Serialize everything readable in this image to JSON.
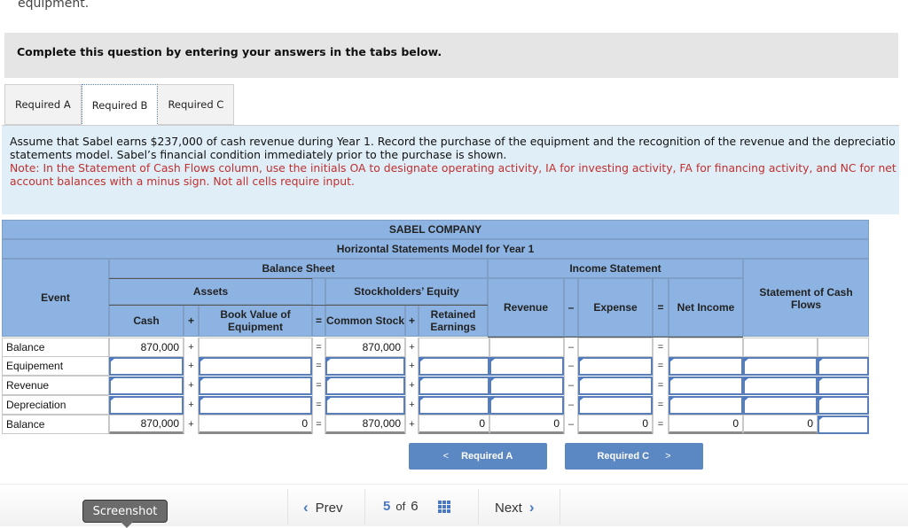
{
  "page": {
    "top_fragment": "equipment.",
    "instruction_bar": "Complete this question by entering your answers in the tabs below."
  },
  "tabs": [
    {
      "label": "Required A",
      "active": false
    },
    {
      "label": "Required B",
      "active": true
    },
    {
      "label": "Required C",
      "active": false
    }
  ],
  "question": {
    "text": "Assume that Sabel earns $237,000 of cash revenue during Year 1. Record the purchase of the equipment and the recognition of the revenue and the depreciatio",
    "text2": "statements model. Sabel’s financial condition immediately prior to the purchase is shown.",
    "note": "Note: In the Statement of Cash Flows column, use the initials OA to designate operating activity, IA for investing activity, FA for financing activity, and NC for net",
    "note2": "account balances with a minus sign. Not all cells require input."
  },
  "model": {
    "company": "SABEL COMPANY",
    "title": "Horizontal Statements Model for Year 1",
    "headers": {
      "event": "Event",
      "balance_sheet": "Balance Sheet",
      "income_statement": "Income Statement",
      "cash_flows": "Statement of Cash Flows",
      "assets": "Assets",
      "equity": "Stockholders’ Equity",
      "cash": "Cash",
      "book_value": "Book Value of Equipment",
      "common_stock": "Common Stock",
      "retained_earnings": "Retained Earnings",
      "revenue": "Revenue",
      "expense": "Expense",
      "net_income": "Net Income"
    },
    "operators": {
      "plus": "+",
      "equals": "=",
      "minus": "–"
    },
    "rows": [
      {
        "event": "Balance",
        "cash": "870,000",
        "book_value": "",
        "common_stock": "870,000",
        "retained_earnings": "",
        "revenue": "",
        "expense": "",
        "net_income": "",
        "scf_amount": "",
        "scf_type": "",
        "editable": false
      },
      {
        "event": "Equipement",
        "cash": "",
        "book_value": "",
        "common_stock": "",
        "retained_earnings": "",
        "revenue": "",
        "expense": "",
        "net_income": "",
        "scf_amount": "",
        "scf_type": "",
        "editable": true
      },
      {
        "event": "Revenue",
        "cash": "",
        "book_value": "",
        "common_stock": "",
        "retained_earnings": "",
        "revenue": "",
        "expense": "",
        "net_income": "",
        "scf_amount": "",
        "scf_type": "",
        "editable": true
      },
      {
        "event": "Depreciation",
        "cash": "",
        "book_value": "",
        "common_stock": "",
        "retained_earnings": "",
        "revenue": "",
        "expense": "",
        "net_income": "",
        "scf_amount": "",
        "scf_type": "",
        "editable": true
      },
      {
        "event": "Balance",
        "cash": "870,000",
        "book_value": "0",
        "common_stock": "870,000",
        "retained_earnings": "0",
        "revenue": "0",
        "expense": "0",
        "net_income": "0",
        "scf_amount": "0",
        "scf_type": "",
        "editable": false
      }
    ]
  },
  "buttons": {
    "prev_required": "Required A",
    "next_required": "Required C"
  },
  "footer": {
    "tooltip": "Screenshot",
    "prev": "Prev",
    "page_current": "5",
    "page_of": "of",
    "page_total": "6",
    "next": "Next"
  }
}
